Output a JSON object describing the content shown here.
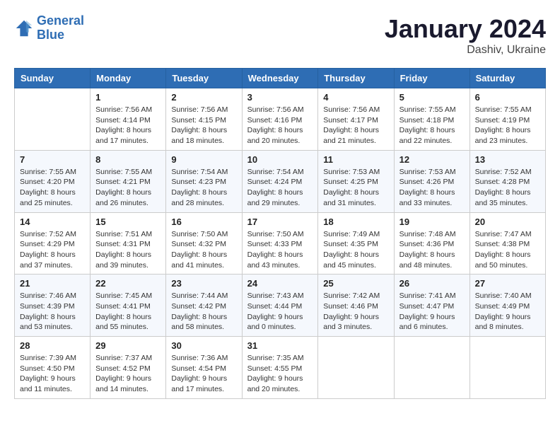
{
  "logo": {
    "line1": "General",
    "line2": "Blue"
  },
  "title": "January 2024",
  "location": "Dashiv, Ukraine",
  "weekdays": [
    "Sunday",
    "Monday",
    "Tuesday",
    "Wednesday",
    "Thursday",
    "Friday",
    "Saturday"
  ],
  "weeks": [
    [
      {
        "day": "",
        "sunrise": "",
        "sunset": "",
        "daylight": ""
      },
      {
        "day": "1",
        "sunrise": "Sunrise: 7:56 AM",
        "sunset": "Sunset: 4:14 PM",
        "daylight": "Daylight: 8 hours and 17 minutes."
      },
      {
        "day": "2",
        "sunrise": "Sunrise: 7:56 AM",
        "sunset": "Sunset: 4:15 PM",
        "daylight": "Daylight: 8 hours and 18 minutes."
      },
      {
        "day": "3",
        "sunrise": "Sunrise: 7:56 AM",
        "sunset": "Sunset: 4:16 PM",
        "daylight": "Daylight: 8 hours and 20 minutes."
      },
      {
        "day": "4",
        "sunrise": "Sunrise: 7:56 AM",
        "sunset": "Sunset: 4:17 PM",
        "daylight": "Daylight: 8 hours and 21 minutes."
      },
      {
        "day": "5",
        "sunrise": "Sunrise: 7:55 AM",
        "sunset": "Sunset: 4:18 PM",
        "daylight": "Daylight: 8 hours and 22 minutes."
      },
      {
        "day": "6",
        "sunrise": "Sunrise: 7:55 AM",
        "sunset": "Sunset: 4:19 PM",
        "daylight": "Daylight: 8 hours and 23 minutes."
      }
    ],
    [
      {
        "day": "7",
        "sunrise": "Sunrise: 7:55 AM",
        "sunset": "Sunset: 4:20 PM",
        "daylight": "Daylight: 8 hours and 25 minutes."
      },
      {
        "day": "8",
        "sunrise": "Sunrise: 7:55 AM",
        "sunset": "Sunset: 4:21 PM",
        "daylight": "Daylight: 8 hours and 26 minutes."
      },
      {
        "day": "9",
        "sunrise": "Sunrise: 7:54 AM",
        "sunset": "Sunset: 4:23 PM",
        "daylight": "Daylight: 8 hours and 28 minutes."
      },
      {
        "day": "10",
        "sunrise": "Sunrise: 7:54 AM",
        "sunset": "Sunset: 4:24 PM",
        "daylight": "Daylight: 8 hours and 29 minutes."
      },
      {
        "day": "11",
        "sunrise": "Sunrise: 7:53 AM",
        "sunset": "Sunset: 4:25 PM",
        "daylight": "Daylight: 8 hours and 31 minutes."
      },
      {
        "day": "12",
        "sunrise": "Sunrise: 7:53 AM",
        "sunset": "Sunset: 4:26 PM",
        "daylight": "Daylight: 8 hours and 33 minutes."
      },
      {
        "day": "13",
        "sunrise": "Sunrise: 7:52 AM",
        "sunset": "Sunset: 4:28 PM",
        "daylight": "Daylight: 8 hours and 35 minutes."
      }
    ],
    [
      {
        "day": "14",
        "sunrise": "Sunrise: 7:52 AM",
        "sunset": "Sunset: 4:29 PM",
        "daylight": "Daylight: 8 hours and 37 minutes."
      },
      {
        "day": "15",
        "sunrise": "Sunrise: 7:51 AM",
        "sunset": "Sunset: 4:31 PM",
        "daylight": "Daylight: 8 hours and 39 minutes."
      },
      {
        "day": "16",
        "sunrise": "Sunrise: 7:50 AM",
        "sunset": "Sunset: 4:32 PM",
        "daylight": "Daylight: 8 hours and 41 minutes."
      },
      {
        "day": "17",
        "sunrise": "Sunrise: 7:50 AM",
        "sunset": "Sunset: 4:33 PM",
        "daylight": "Daylight: 8 hours and 43 minutes."
      },
      {
        "day": "18",
        "sunrise": "Sunrise: 7:49 AM",
        "sunset": "Sunset: 4:35 PM",
        "daylight": "Daylight: 8 hours and 45 minutes."
      },
      {
        "day": "19",
        "sunrise": "Sunrise: 7:48 AM",
        "sunset": "Sunset: 4:36 PM",
        "daylight": "Daylight: 8 hours and 48 minutes."
      },
      {
        "day": "20",
        "sunrise": "Sunrise: 7:47 AM",
        "sunset": "Sunset: 4:38 PM",
        "daylight": "Daylight: 8 hours and 50 minutes."
      }
    ],
    [
      {
        "day": "21",
        "sunrise": "Sunrise: 7:46 AM",
        "sunset": "Sunset: 4:39 PM",
        "daylight": "Daylight: 8 hours and 53 minutes."
      },
      {
        "day": "22",
        "sunrise": "Sunrise: 7:45 AM",
        "sunset": "Sunset: 4:41 PM",
        "daylight": "Daylight: 8 hours and 55 minutes."
      },
      {
        "day": "23",
        "sunrise": "Sunrise: 7:44 AM",
        "sunset": "Sunset: 4:42 PM",
        "daylight": "Daylight: 8 hours and 58 minutes."
      },
      {
        "day": "24",
        "sunrise": "Sunrise: 7:43 AM",
        "sunset": "Sunset: 4:44 PM",
        "daylight": "Daylight: 9 hours and 0 minutes."
      },
      {
        "day": "25",
        "sunrise": "Sunrise: 7:42 AM",
        "sunset": "Sunset: 4:46 PM",
        "daylight": "Daylight: 9 hours and 3 minutes."
      },
      {
        "day": "26",
        "sunrise": "Sunrise: 7:41 AM",
        "sunset": "Sunset: 4:47 PM",
        "daylight": "Daylight: 9 hours and 6 minutes."
      },
      {
        "day": "27",
        "sunrise": "Sunrise: 7:40 AM",
        "sunset": "Sunset: 4:49 PM",
        "daylight": "Daylight: 9 hours and 8 minutes."
      }
    ],
    [
      {
        "day": "28",
        "sunrise": "Sunrise: 7:39 AM",
        "sunset": "Sunset: 4:50 PM",
        "daylight": "Daylight: 9 hours and 11 minutes."
      },
      {
        "day": "29",
        "sunrise": "Sunrise: 7:37 AM",
        "sunset": "Sunset: 4:52 PM",
        "daylight": "Daylight: 9 hours and 14 minutes."
      },
      {
        "day": "30",
        "sunrise": "Sunrise: 7:36 AM",
        "sunset": "Sunset: 4:54 PM",
        "daylight": "Daylight: 9 hours and 17 minutes."
      },
      {
        "day": "31",
        "sunrise": "Sunrise: 7:35 AM",
        "sunset": "Sunset: 4:55 PM",
        "daylight": "Daylight: 9 hours and 20 minutes."
      },
      {
        "day": "",
        "sunrise": "",
        "sunset": "",
        "daylight": ""
      },
      {
        "day": "",
        "sunrise": "",
        "sunset": "",
        "daylight": ""
      },
      {
        "day": "",
        "sunrise": "",
        "sunset": "",
        "daylight": ""
      }
    ]
  ]
}
